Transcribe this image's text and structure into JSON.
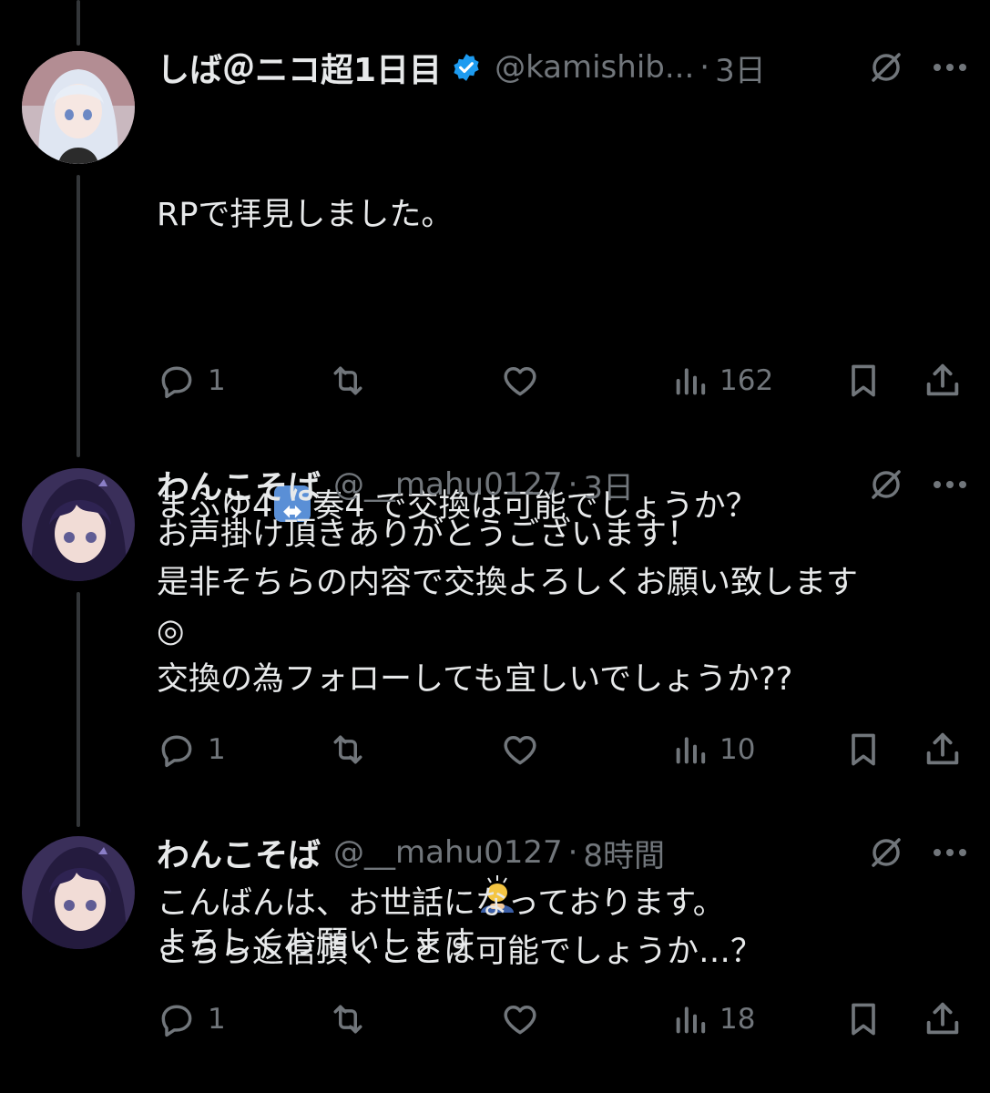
{
  "tweets": [
    {
      "display_name": "しば＠ニコ超1日目",
      "verified": true,
      "handle": "@kamishib...",
      "time": "3日",
      "body_line1": "RPで拝見しました。",
      "body_line2_pre": "まふゆ4",
      "body_line2_emoji": "⬌",
      "body_line2_post": "奏4 で交換は可能でしょうか？",
      "body_line3": "よろしくお願いします",
      "replies": "1",
      "reposts": "",
      "likes": "",
      "views": "162"
    },
    {
      "display_name": "わんこそば",
      "verified": false,
      "handle": "@__mahu0127",
      "time": "3日",
      "body": "お声掛け頂きありがとうございます！\n是非そちらの内容で交換よろしくお願い致します\n◎\n交換の為フォローしても宜しいでしょうか??",
      "replies": "1",
      "reposts": "",
      "likes": "",
      "views": "10"
    },
    {
      "display_name": "わんこそば",
      "verified": false,
      "handle": "@__mahu0127",
      "time": "8時間",
      "body": "こんばんは、お世話になっております。\nこちら返信頂くことは可能でしょうか…？",
      "replies": "1",
      "reposts": "",
      "likes": "",
      "views": "18"
    }
  ],
  "colors": {
    "background": "#000000",
    "text": "#e7e9ea",
    "secondary": "#71767b",
    "verified": "#1d9bf0",
    "thread_line": "#333639"
  },
  "icons": [
    "reply-icon",
    "repost-icon",
    "like-icon",
    "views-icon",
    "bookmark-icon",
    "share-icon",
    "grok-icon",
    "more-icon",
    "verified-badge-icon"
  ]
}
